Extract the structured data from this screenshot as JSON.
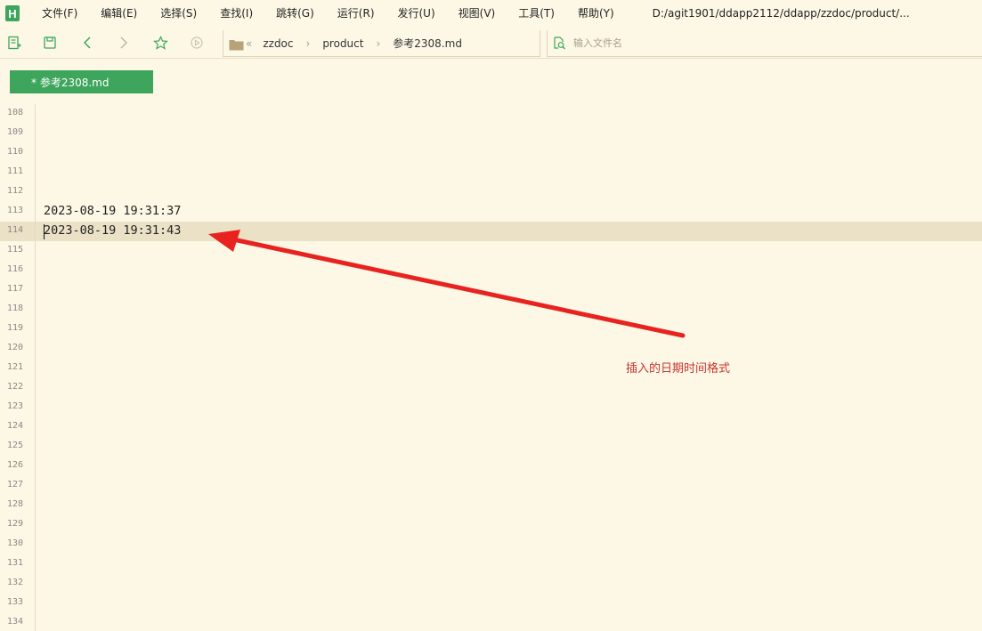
{
  "app": {
    "logo_letter": "H"
  },
  "menu": [
    {
      "id": "file",
      "label": "文件(F)"
    },
    {
      "id": "edit",
      "label": "编辑(E)"
    },
    {
      "id": "select",
      "label": "选择(S)"
    },
    {
      "id": "find",
      "label": "查找(I)"
    },
    {
      "id": "goto",
      "label": "跳转(G)"
    },
    {
      "id": "run",
      "label": "运行(R)"
    },
    {
      "id": "publish",
      "label": "发行(U)"
    },
    {
      "id": "view",
      "label": "视图(V)"
    },
    {
      "id": "tools",
      "label": "工具(T)"
    },
    {
      "id": "help",
      "label": "帮助(Y)"
    }
  ],
  "file_path": "D:/agit1901/ddapp2112/ddapp/zzdoc/product/...",
  "breadcrumb": {
    "collapse": "«",
    "items": [
      "zzdoc",
      "product",
      "参考2308.md"
    ],
    "separator": "›"
  },
  "file_search": {
    "placeholder": "输入文件名"
  },
  "tab": {
    "label": "* 参考2308.md"
  },
  "editor": {
    "current_line": 114,
    "lines": [
      {
        "n": "108",
        "text": ""
      },
      {
        "n": "109",
        "text": ""
      },
      {
        "n": "110",
        "text": ""
      },
      {
        "n": "111",
        "text": ""
      },
      {
        "n": "112",
        "text": ""
      },
      {
        "n": "113",
        "text": "2023-08-19 19:31:37"
      },
      {
        "n": "114",
        "text": "2023-08-19 19:31:43"
      },
      {
        "n": "115",
        "text": ""
      },
      {
        "n": "116",
        "text": ""
      },
      {
        "n": "117",
        "text": ""
      },
      {
        "n": "118",
        "text": ""
      },
      {
        "n": "119",
        "text": ""
      },
      {
        "n": "120",
        "text": ""
      },
      {
        "n": "121",
        "text": ""
      },
      {
        "n": "122",
        "text": ""
      },
      {
        "n": "123",
        "text": ""
      },
      {
        "n": "124",
        "text": ""
      },
      {
        "n": "125",
        "text": ""
      },
      {
        "n": "126",
        "text": ""
      },
      {
        "n": "127",
        "text": ""
      },
      {
        "n": "128",
        "text": ""
      },
      {
        "n": "129",
        "text": ""
      },
      {
        "n": "130",
        "text": ""
      },
      {
        "n": "131",
        "text": ""
      },
      {
        "n": "132",
        "text": ""
      },
      {
        "n": "133",
        "text": ""
      },
      {
        "n": "134",
        "text": ""
      }
    ]
  },
  "annotation": {
    "label": "插入的日期时间格式",
    "color": "#e8231f"
  },
  "colors": {
    "accent": "#3ea55c",
    "background": "#fdf8e6",
    "current_line": "#ebe1c6"
  }
}
